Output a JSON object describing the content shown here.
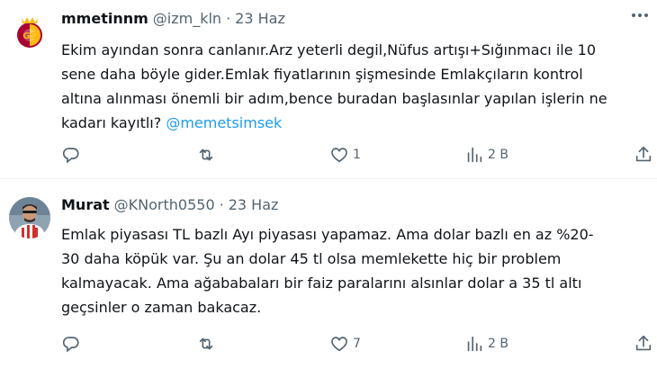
{
  "tweets": [
    {
      "display_name": "mmetinnm",
      "handle": "@izm_kln",
      "dot": "·",
      "date": "23 Haz",
      "text_lines": [
        "Ekim ayından sonra canlanır.Arz yeterli degil,Nüfus artışı+Sığınmacı ile 10",
        "sene daha böyle gider.Emlak fiyatlarının şişmesinde Emlakçıların kontrol",
        "altına alınması önemli bir adım,bence buradan başlasınlar yapılan işlerin ne"
      ],
      "last_line_text": "kadarı kayıtlı? ",
      "mention": "@memetsimsek",
      "reply_count": "",
      "retweet_count": "",
      "like_count": "1",
      "view_count": "2 B",
      "avatar_icon": "galatasaray-logo",
      "colors": {
        "avatar_bg": "#ffffff",
        "crest_red": "#a90432",
        "crest_yellow": "#fdb912"
      }
    },
    {
      "display_name": "Murat",
      "handle": "@KNorth0550",
      "dot": "·",
      "date": "23 Haz",
      "text_lines": [
        "Emlak piyasası TL bazlı Ayı piyasası yapamaz. Ama dolar bazlı en az %20-",
        "30 daha köpük var. Şu an dolar 45 tl olsa memlekette hiç bir problem",
        "kalmayacak. Ama ağababaları bir faiz paralarını alsınlar dolar a 35 tl altı",
        "geçsinler o zaman bakacaz."
      ],
      "reply_count": "",
      "retweet_count": "",
      "like_count": "7",
      "view_count": "2 B",
      "avatar_icon": "user-photo"
    }
  ],
  "colors": {
    "text": "#0f1419",
    "secondary": "#536471",
    "link": "#1d9bf0",
    "divider": "#eff3f4"
  },
  "icons": [
    "reply-icon",
    "retweet-icon",
    "like-icon",
    "views-icon",
    "share-icon",
    "more-options-icon"
  ]
}
